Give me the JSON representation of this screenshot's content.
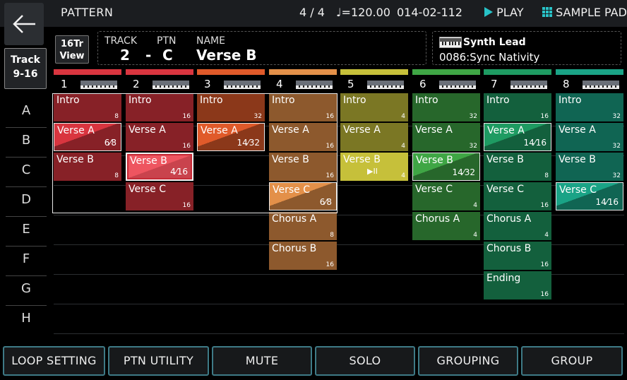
{
  "header": {
    "title": "PATTERN",
    "time_signature": "4 / 4",
    "tempo_symbol": "♩=120.00",
    "position": "014-02-112",
    "play_label": "PLAY",
    "sample_pad_label": "SAMPLE PAD"
  },
  "view_button": {
    "line1": "16Tr",
    "line2": "View"
  },
  "track_info": {
    "track_label": "TRACK",
    "ptn_label": "PTN",
    "name_label": "NAME",
    "track_value": "2",
    "dash": "-",
    "ptn_value": "C",
    "name_value": "Verse B"
  },
  "tone": {
    "name": "Synth Lead",
    "number": "0086:Sync Nativity"
  },
  "track_range": {
    "line1": "Track",
    "line2": "9-16"
  },
  "rows": [
    "A",
    "B",
    "C",
    "D",
    "E",
    "F",
    "G",
    "H"
  ],
  "tracks": [
    {
      "number": "1",
      "color": "#d9353f"
    },
    {
      "number": "2",
      "color": "#d9353f"
    },
    {
      "number": "3",
      "color": "#e05a2a"
    },
    {
      "number": "4",
      "color": "#e39049"
    },
    {
      "number": "5",
      "color": "#c6c03a"
    },
    {
      "number": "6",
      "color": "#3fa645"
    },
    {
      "number": "7",
      "color": "#1e9b62"
    },
    {
      "number": "8",
      "color": "#1aa386"
    }
  ],
  "patterns": [
    [
      {
        "name": "Intro",
        "len": "8"
      },
      {
        "name": "Verse A",
        "frac": "6⁄8",
        "state": "playing"
      },
      {
        "name": "Verse B",
        "len": "8"
      },
      null,
      null,
      null,
      null,
      null
    ],
    [
      {
        "name": "Intro",
        "len": "16"
      },
      {
        "name": "Verse A",
        "len": "16"
      },
      {
        "name": "Verse B",
        "frac": "4⁄16",
        "state": "selected"
      },
      {
        "name": "Verse C",
        "len": "16"
      },
      null,
      null,
      null,
      null
    ],
    [
      {
        "name": "Intro",
        "len": "32"
      },
      {
        "name": "Verse A",
        "frac": "14⁄32",
        "state": "playing"
      },
      null,
      null,
      null,
      null,
      null,
      null
    ],
    [
      {
        "name": "Intro",
        "len": "16"
      },
      {
        "name": "Verse A",
        "len": "16"
      },
      {
        "name": "Verse B",
        "len": "16"
      },
      {
        "name": "Verse C",
        "frac": "6⁄8",
        "state": "playing"
      },
      {
        "name": "Chorus A",
        "len": "8"
      },
      {
        "name": "Chorus B",
        "len": "16"
      },
      null,
      null
    ],
    [
      {
        "name": "Intro",
        "len": "4"
      },
      {
        "name": "Verse A",
        "len": "4"
      },
      {
        "name": "Verse B",
        "len": "4",
        "state": "queued",
        "icon": "▶II"
      },
      null,
      null,
      null,
      null,
      null
    ],
    [
      {
        "name": "Intro",
        "len": "32"
      },
      {
        "name": "Verse A",
        "len": "32"
      },
      {
        "name": "Verse B",
        "frac": "14⁄32",
        "state": "playing"
      },
      {
        "name": "Verse C",
        "len": "4"
      },
      {
        "name": "Chorus A",
        "len": "4"
      },
      null,
      null,
      null
    ],
    [
      {
        "name": "Intro",
        "len": "16"
      },
      {
        "name": "Verse A",
        "frac": "14⁄16",
        "state": "playing"
      },
      {
        "name": "Verse B",
        "len": "8"
      },
      {
        "name": "Verse C",
        "len": "16"
      },
      {
        "name": "Chorus A",
        "len": "4"
      },
      {
        "name": "Chorus B",
        "len": "16"
      },
      {
        "name": "Ending",
        "len": "16"
      },
      null
    ],
    [
      {
        "name": "Intro",
        "len": "32"
      },
      {
        "name": "Verse A",
        "len": "32"
      },
      {
        "name": "Verse B",
        "len": "32"
      },
      {
        "name": "Verse C",
        "frac": "14⁄16",
        "state": "playing"
      },
      null,
      null,
      null,
      null
    ]
  ],
  "bottom_buttons": [
    "LOOP SETTING",
    "PTN UTILITY",
    "MUTE",
    "SOLO",
    "GROUPING",
    "GROUP"
  ]
}
